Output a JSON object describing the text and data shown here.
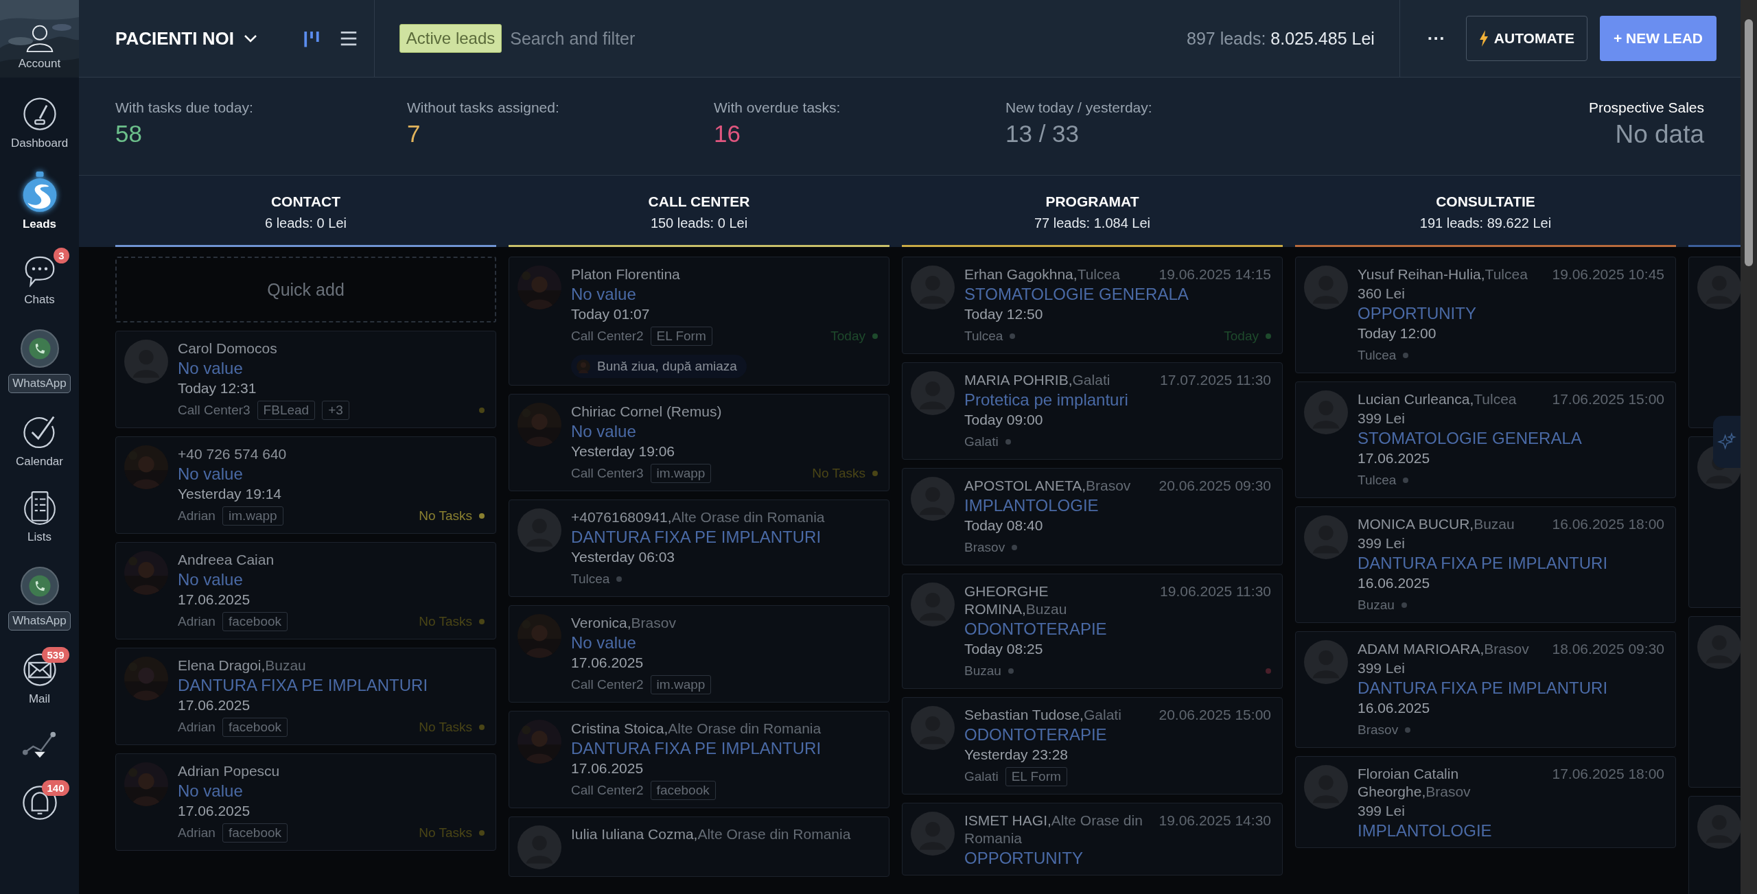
{
  "sidebar": {
    "items": [
      {
        "kind": "account",
        "label": "Account",
        "selected": false
      },
      {
        "kind": "dashboard",
        "label": "Dashboard",
        "selected": false
      },
      {
        "kind": "leads",
        "label": "Leads",
        "selected": true
      },
      {
        "kind": "chats",
        "label": "Chats",
        "badge": "3",
        "selected": false
      },
      {
        "kind": "whatsapp",
        "label": "WhatsApp",
        "selected": false
      },
      {
        "kind": "calendar",
        "label": "Calendar",
        "selected": false
      },
      {
        "kind": "lists",
        "label": "Lists",
        "selected": false
      },
      {
        "kind": "whatsapp",
        "label": "WhatsApp",
        "selected": false
      },
      {
        "kind": "mail",
        "label": "Mail",
        "badge": "539",
        "selected": false
      },
      {
        "kind": "analytics",
        "selected": false
      },
      {
        "kind": "notifications",
        "badge": "140",
        "selected": false
      }
    ]
  },
  "header": {
    "pipeline": "PACIENTI NOI",
    "views": [
      {
        "kind": "pipeline",
        "selected": true
      },
      {
        "kind": "list",
        "selected": false
      }
    ],
    "search": {
      "filter_tag": "Active leads",
      "placeholder": "Search and filter"
    },
    "leads_count": "897 leads:",
    "leads_total": "8.025.485 Lei",
    "more": "···",
    "automate": "AUTOMATE",
    "new_lead": "+ NEW LEAD"
  },
  "stats": [
    {
      "label": "With tasks due today:",
      "value": "58",
      "color": "#6cc08b"
    },
    {
      "label": "Without tasks assigned:",
      "value": "7",
      "color": "#e2b45c"
    },
    {
      "label": "With overdue tasks:",
      "value": "16",
      "color": "#e0567f"
    },
    {
      "label": "New today / yesterday:",
      "value": "13 / 33",
      "color": "#8a96a3"
    }
  ],
  "prospective": {
    "label": "Prospective Sales",
    "value": "No data"
  },
  "columns": [
    {
      "title": "CONTACT",
      "summary": "6 leads: 0 Lei",
      "color": "#7094d2",
      "quick_add": "Quick add",
      "cards": [
        {
          "photo": false,
          "name": "Carol Domocos",
          "value": "No value",
          "date": "Today 12:31",
          "source": "Call Center3",
          "tags": [
            "FBLead",
            "+3"
          ],
          "status": {
            "color": "#4a4516"
          }
        },
        {
          "photo": true,
          "name": "+40 726 574 640",
          "value": "No value",
          "date": "Yesterday 19:14",
          "source": "Adrian",
          "tags": [
            "im.wapp"
          ],
          "status": {
            "text": "No Tasks",
            "color": "#8a8030"
          }
        },
        {
          "photo": true,
          "name": "Andreea Caian",
          "value": "No value",
          "date": "17.06.2025",
          "source": "Adrian",
          "tags": [
            "facebook"
          ],
          "status": {
            "text": "No Tasks",
            "color": "#4a4516"
          }
        },
        {
          "photo": true,
          "name": "Elena Dragoi,",
          "city": "Buzau",
          "value": "DANTURA FIXA PE IMPLANTURI",
          "date": "17.06.2025",
          "source": "Adrian",
          "tags": [
            "facebook"
          ],
          "status": {
            "text": "No Tasks",
            "color": "#4a4516"
          }
        },
        {
          "photo": true,
          "name": "Adrian Popescu",
          "value": "No value",
          "date": "17.06.2025",
          "source": "Adrian",
          "tags": [
            "facebook"
          ],
          "status": {
            "text": "No Tasks",
            "color": "#4a4516"
          }
        }
      ]
    },
    {
      "title": "CALL CENTER",
      "summary": "150 leads: 0 Lei",
      "color": "#c9c06a",
      "cards": [
        {
          "photo": true,
          "name": "Platon Florentina",
          "value": "No value",
          "date": "Today 01:07",
          "source": "Call Center2",
          "tags": [
            "EL Form"
          ],
          "status": {
            "text": "Today",
            "color": "#1e4a2c"
          },
          "message": "Bună ziua, după amiaza"
        },
        {
          "photo": true,
          "name": "Chiriac Cornel (Remus)",
          "value": "No value",
          "date": "Yesterday 19:06",
          "source": "Call Center3",
          "tags": [
            "im.wapp"
          ],
          "status": {
            "text": "No Tasks",
            "color": "#4a4516"
          }
        },
        {
          "photo": false,
          "name": "+40761680941,",
          "city": "Alte Orase din Romania",
          "value": "DANTURA FIXA PE IMPLANTURI",
          "date": "Yesterday 06:03",
          "source": "Tulcea",
          "source_dot": true
        },
        {
          "photo": true,
          "name": "Veronica,",
          "city": "Brasov",
          "value": "No value",
          "date": "17.06.2025",
          "source": "Call Center2",
          "tags": [
            "im.wapp"
          ]
        },
        {
          "photo": true,
          "name": "Cristina Stoica,",
          "city": "Alte Orase din Romania",
          "value": "DANTURA FIXA PE IMPLANTURI",
          "date": "17.06.2025",
          "source": "Call Center2",
          "tags": [
            "facebook"
          ]
        },
        {
          "photo": false,
          "name": "Iulia Iuliana Cozma,",
          "city": "Alte Orase din Romania"
        }
      ]
    },
    {
      "title": "PROGRAMAT",
      "summary": "77 leads: 1.084 Lei",
      "color": "#c9aa45",
      "cards": [
        {
          "photo": false,
          "name": "Erhan Gagokhna,",
          "city": "Tulcea",
          "appointment": "19.06.2025 14:15",
          "value": "STOMATOLOGIE GENERALA",
          "date": "Today 12:50",
          "source": "Tulcea",
          "source_dot": true,
          "status": {
            "text": "Today",
            "color": "#1e4a2c"
          }
        },
        {
          "photo": false,
          "name": "MARIA POHRIB,",
          "city": "Galati",
          "appointment": "17.07.2025 11:30",
          "value": "Protetica pe implanturi",
          "date": "Today 09:00",
          "source": "Galati",
          "source_dot": true
        },
        {
          "photo": false,
          "name": "APOSTOL ANETA,",
          "city": "Brasov",
          "appointment": "20.06.2025 09:30",
          "value": "IMPLANTOLOGIE",
          "date": "Today 08:40",
          "source": "Brasov",
          "source_dot": true
        },
        {
          "photo": false,
          "name": "GHEORGHE ROMINA,",
          "city": "Buzau",
          "appointment": "19.06.2025 11:30",
          "value": "ODONTOTERAPIE",
          "date": "Today 08:25",
          "source": "Buzau",
          "source_dot": true,
          "status": {
            "color": "#4a1f2a"
          }
        },
        {
          "photo": false,
          "name": "Sebastian Tudose,",
          "city": "Galati",
          "appointment": "20.06.2025 15:00",
          "value": "ODONTOTERAPIE",
          "date": "Yesterday 23:28",
          "source": "Galati",
          "tags": [
            "EL Form"
          ]
        },
        {
          "photo": false,
          "name": "ISMET HAGI,",
          "city": "Alte Orase din Romania",
          "appointment": "19.06.2025 14:30",
          "value": "OPPORTUNITY"
        }
      ]
    },
    {
      "title": "CONSULTATIE",
      "summary": "191 leads: 89.622 Lei",
      "color": "#b86a3c",
      "cards": [
        {
          "photo": false,
          "name": "Yusuf Reihan-Hulia,",
          "city": "Tulcea",
          "appointment": "19.06.2025 10:45",
          "price": "360 Lei",
          "value": "OPPORTUNITY",
          "date": "Today 12:00",
          "source": "Tulcea",
          "source_dot": true
        },
        {
          "photo": false,
          "name": "Lucian Curleanca,",
          "city": "Tulcea",
          "appointment": "17.06.2025 15:00",
          "price": "399 Lei",
          "value": "STOMATOLOGIE GENERALA",
          "date": "17.06.2025",
          "source": "Tulcea",
          "source_dot": true
        },
        {
          "photo": false,
          "name": "MONICA BUCUR,",
          "city": "Buzau",
          "appointment": "16.06.2025 18:00",
          "price": "399 Lei",
          "value": "DANTURA FIXA PE IMPLANTURI",
          "date": "16.06.2025",
          "source": "Buzau",
          "source_dot": true
        },
        {
          "photo": false,
          "name": "ADAM MARIOARA,",
          "city": "Brasov",
          "appointment": "18.06.2025 09:30",
          "price": "399 Lei",
          "value": "DANTURA FIXA PE IMPLANTURI",
          "date": "16.06.2025",
          "source": "Brasov",
          "source_dot": true
        },
        {
          "photo": false,
          "name": "Floroian Catalin Gheorghe,",
          "city": "Brasov",
          "appointment": "17.06.2025 18:00",
          "price": "399 Lei",
          "value": "IMPLANTOLOGIE"
        }
      ]
    }
  ]
}
